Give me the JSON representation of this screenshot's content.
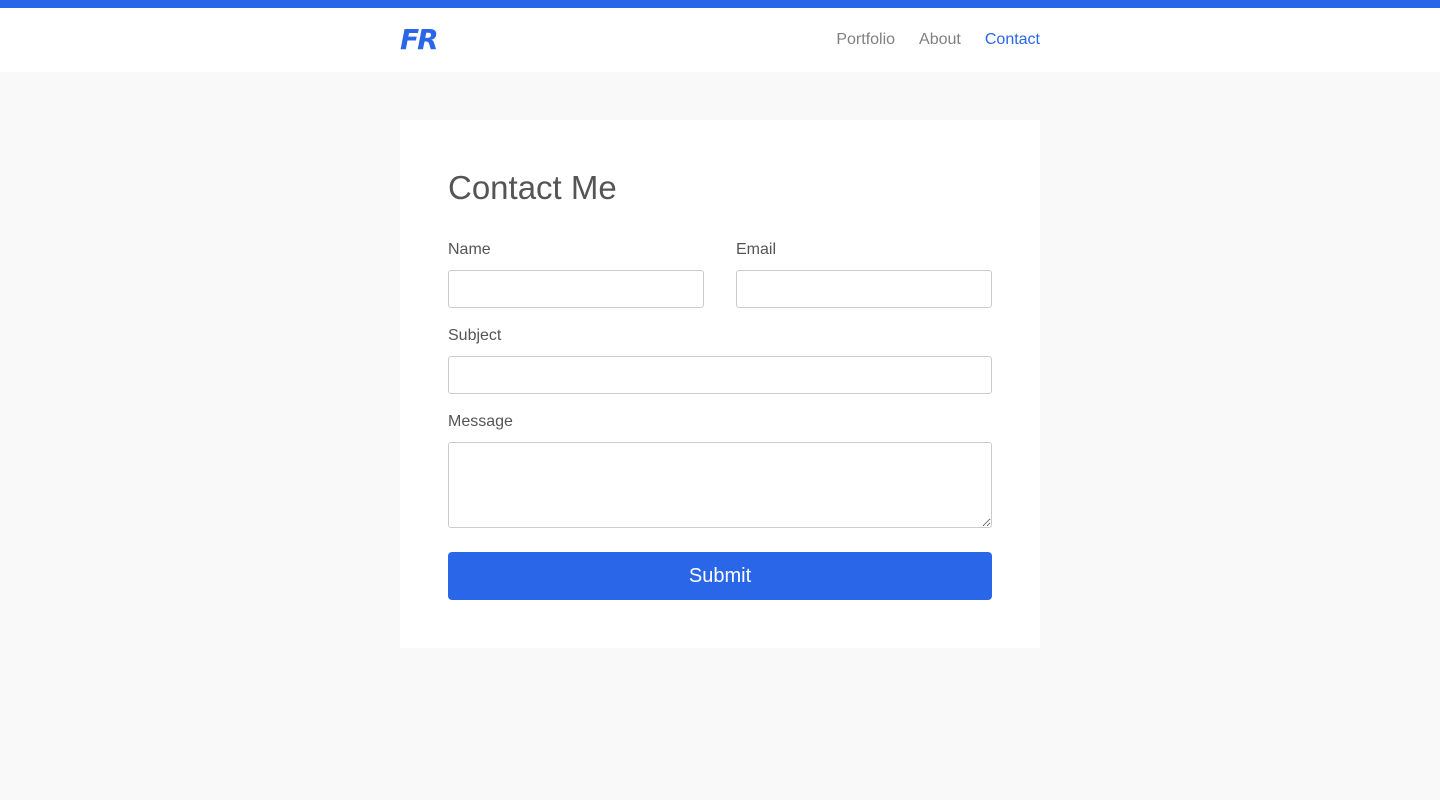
{
  "brand": {
    "logo_text": "FR",
    "accent_color": "#2a66e8"
  },
  "nav": {
    "items": [
      {
        "label": "Portfolio",
        "active": false
      },
      {
        "label": "About",
        "active": false
      },
      {
        "label": "Contact",
        "active": true
      }
    ]
  },
  "form": {
    "title": "Contact Me",
    "name": {
      "label": "Name",
      "value": "",
      "placeholder": ""
    },
    "email": {
      "label": "Email",
      "value": "",
      "placeholder": ""
    },
    "subject": {
      "label": "Subject",
      "value": "",
      "placeholder": ""
    },
    "message": {
      "label": "Message",
      "value": "",
      "placeholder": ""
    },
    "submit_label": "Submit"
  }
}
